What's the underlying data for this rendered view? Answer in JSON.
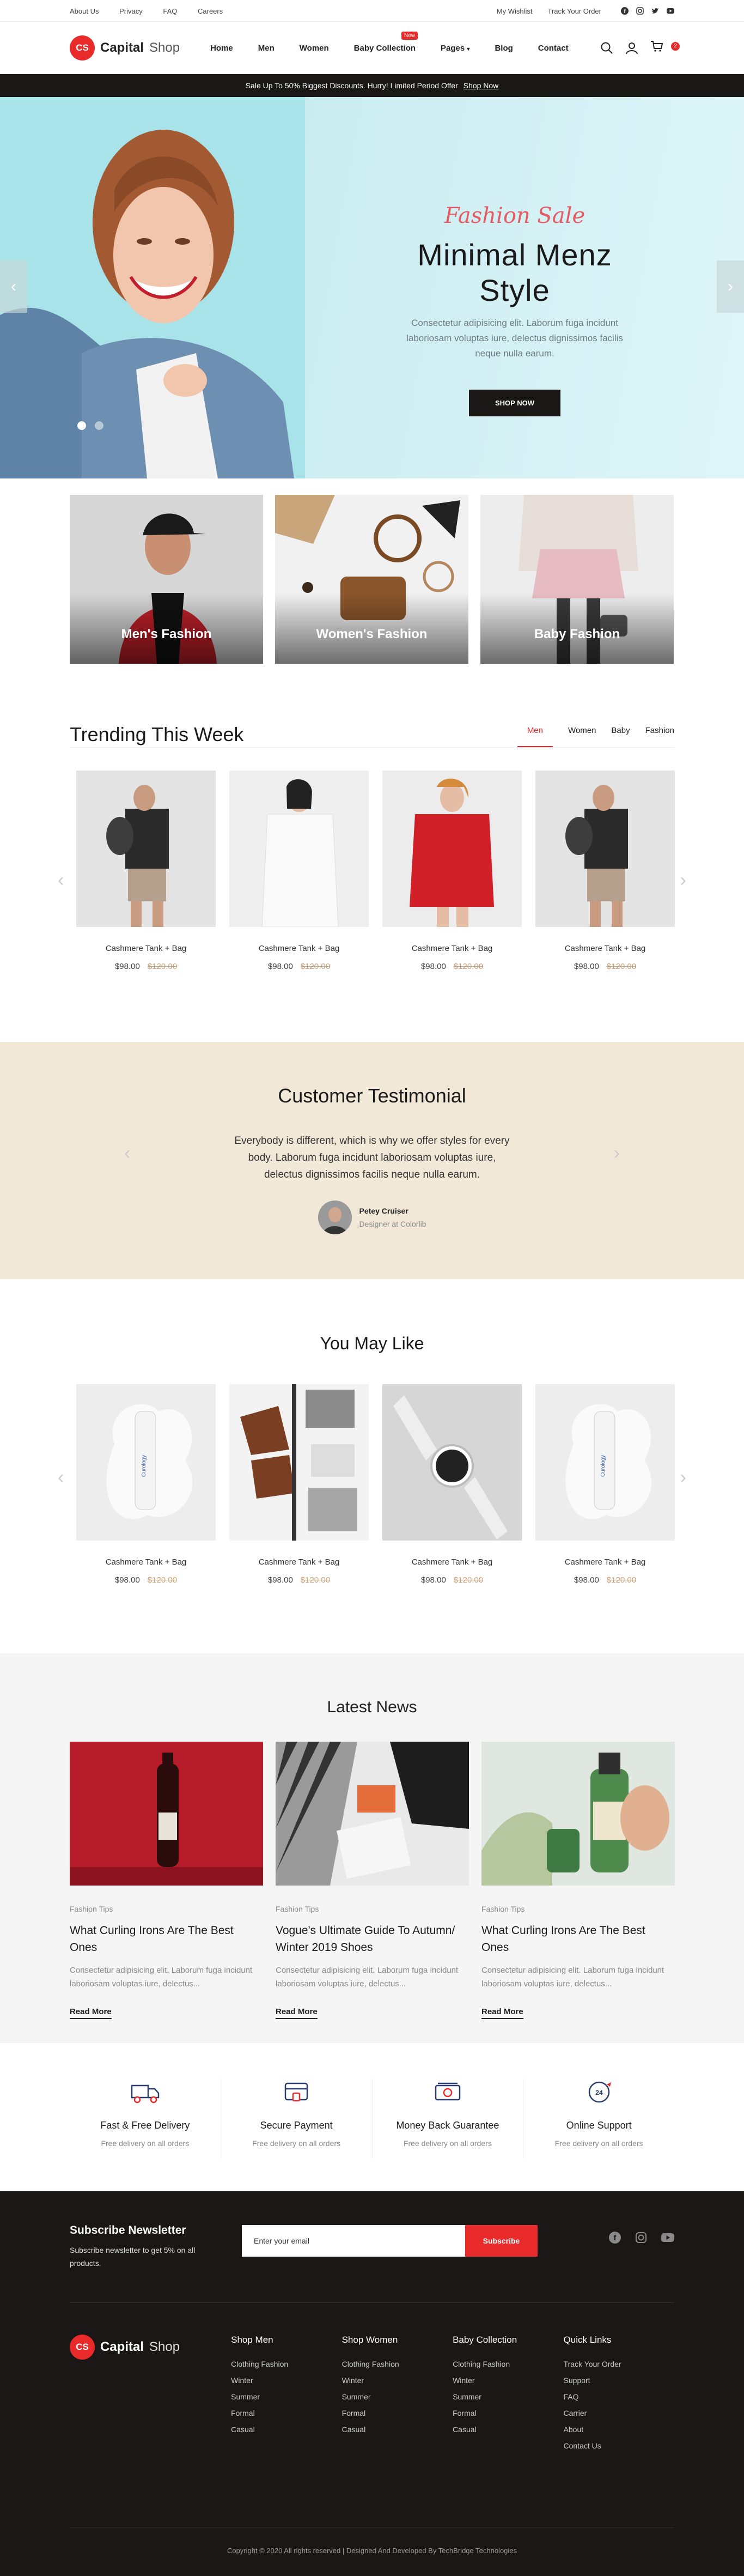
{
  "topbar": {
    "links": [
      "About Us",
      "Privacy",
      "FAQ",
      "Careers"
    ],
    "wishlist": "My Wishlist",
    "track": "Track Your Order"
  },
  "header": {
    "logo_bold": "Capital",
    "logo_thin": "Shop",
    "logo_mark": "CS",
    "nav": [
      "Home",
      "Men",
      "Women",
      "Baby Collection",
      "Pages",
      "Blog",
      "Contact"
    ],
    "new_badge": "New",
    "cart_count": "2"
  },
  "promo": {
    "text": "Sale Up To 50% Biggest Discounts. Hurry! Limited Period Offer",
    "link": "Shop Now"
  },
  "hero": {
    "kicker": "Fashion Sale",
    "title": "Minimal Menz Style",
    "text": "Consectetur adipisicing elit. Laborum fuga incidunt laboriosam voluptas iure, delectus dignissimos facilis neque nulla earum.",
    "button": "SHOP NOW"
  },
  "categories": [
    "Men's Fashion",
    "Women's Fashion",
    "Baby Fashion"
  ],
  "trending": {
    "title": "Trending This Week",
    "tabs": [
      "Men",
      "Women",
      "Baby",
      "Fashion"
    ],
    "products": [
      {
        "name": "Cashmere Tank + Bag",
        "price": "$98.00",
        "old": "$120.00"
      },
      {
        "name": "Cashmere Tank + Bag",
        "price": "$98.00",
        "old": "$120.00"
      },
      {
        "name": "Cashmere Tank + Bag",
        "price": "$98.00",
        "old": "$120.00"
      },
      {
        "name": "Cashmere Tank + Bag",
        "price": "$98.00",
        "old": "$120.00"
      }
    ]
  },
  "testimonial": {
    "title": "Customer Testimonial",
    "quote": "Everybody is different, which is why we offer styles for every body. Laborum fuga incidunt laboriosam voluptas iure, delectus dignissimos facilis neque nulla earum.",
    "name": "Petey Cruiser",
    "role": "Designer at Colorlib"
  },
  "may_like": {
    "title": "You May Like",
    "products": [
      {
        "name": "Cashmere Tank + Bag",
        "price": "$98.00",
        "old": "$120.00"
      },
      {
        "name": "Cashmere Tank + Bag",
        "price": "$98.00",
        "old": "$120.00"
      },
      {
        "name": "Cashmere Tank + Bag",
        "price": "$98.00",
        "old": "$120.00"
      },
      {
        "name": "Cashmere Tank + Bag",
        "price": "$98.00",
        "old": "$120.00"
      }
    ]
  },
  "news": {
    "title": "Latest News",
    "articles": [
      {
        "tag": "Fashion Tips",
        "title": "What Curling Irons Are The Best Ones",
        "text": "Consectetur adipisicing elit. Laborum fuga incidunt laboriosam voluptas iure, delectus...",
        "more": "Read More"
      },
      {
        "tag": "Fashion Tips",
        "title": "Vogue's Ultimate Guide To Autumn/ Winter 2019 Shoes",
        "text": "Consectetur adipisicing elit. Laborum fuga incidunt laboriosam voluptas iure, delectus...",
        "more": "Read More"
      },
      {
        "tag": "Fashion Tips",
        "title": "What Curling Irons Are The Best Ones",
        "text": "Consectetur adipisicing elit. Laborum fuga incidunt laboriosam voluptas iure, delectus...",
        "more": "Read More"
      }
    ]
  },
  "features": [
    {
      "title": "Fast & Free Delivery",
      "sub": "Free delivery on all orders",
      "icon": "truck-icon"
    },
    {
      "title": "Secure Payment",
      "sub": "Free delivery on all orders",
      "icon": "card-icon"
    },
    {
      "title": "Money Back Guarantee",
      "sub": "Free delivery on all orders",
      "icon": "money-icon"
    },
    {
      "title": "Online Support",
      "sub": "Free delivery on all orders",
      "icon": "support-icon"
    }
  ],
  "footer": {
    "sub_title": "Subscribe Newsletter",
    "sub_text": "Subscribe newsletter to get 5% on all products.",
    "email_placeholder": "Enter your email",
    "sub_button": "Subscribe",
    "cols": [
      {
        "title": "Shop Men",
        "items": [
          "Clothing Fashion",
          "Winter",
          "Summer",
          "Formal",
          "Casual"
        ]
      },
      {
        "title": "Shop Women",
        "items": [
          "Clothing Fashion",
          "Winter",
          "Summer",
          "Formal",
          "Casual"
        ]
      },
      {
        "title": "Baby Collection",
        "items": [
          "Clothing Fashion",
          "Winter",
          "Summer",
          "Formal",
          "Casual"
        ]
      },
      {
        "title": "Quick Links",
        "items": [
          "Track Your Order",
          "Support",
          "FAQ",
          "Carrier",
          "About",
          "Contact Us"
        ]
      }
    ],
    "copyright": "Copyright © 2020 All rights reserved | Designed And Developed By TechBridge Technologies"
  },
  "colors": {
    "accent": "#e82a2a",
    "dark": "#1b1717",
    "hero_bg": "#cbedf1",
    "testimonial_bg": "#f2e8d7",
    "news_bg": "#f5f5f5"
  }
}
